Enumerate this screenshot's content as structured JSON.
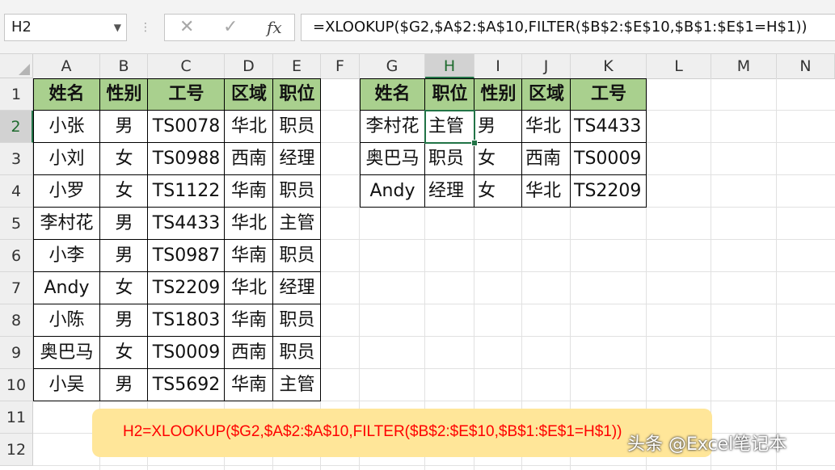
{
  "name_box": {
    "value": "H2"
  },
  "formula_bar": {
    "cancel_icon": "✕",
    "enter_icon": "✓",
    "fx_label": "fx",
    "formula": "=XLOOKUP($G2,$A$2:$A$10,FILTER($B$2:$E$10,$B$1:$E$1=H$1))"
  },
  "columns": [
    "A",
    "B",
    "C",
    "D",
    "E",
    "F",
    "G",
    "H",
    "I",
    "J",
    "K",
    "L",
    "M",
    "N"
  ],
  "rows": [
    "1",
    "2",
    "3",
    "4",
    "5",
    "6",
    "7",
    "8",
    "9",
    "10",
    "11",
    "12"
  ],
  "selected_cell": {
    "col": "H",
    "row": "2"
  },
  "header_color": "#a9d08e",
  "source_table": {
    "headers": [
      "姓名",
      "性别",
      "工号",
      "区域",
      "职位"
    ],
    "rows": [
      [
        "小张",
        "男",
        "TS0078",
        "华北",
        "职员"
      ],
      [
        "小刘",
        "女",
        "TS0988",
        "西南",
        "经理"
      ],
      [
        "小罗",
        "女",
        "TS1122",
        "华南",
        "职员"
      ],
      [
        "李村花",
        "男",
        "TS4433",
        "华北",
        "主管"
      ],
      [
        "小李",
        "男",
        "TS0987",
        "华南",
        "职员"
      ],
      [
        "Andy",
        "女",
        "TS2209",
        "华北",
        "经理"
      ],
      [
        "小陈",
        "男",
        "TS1803",
        "华南",
        "职员"
      ],
      [
        "奥巴马",
        "女",
        "TS0009",
        "西南",
        "职员"
      ],
      [
        "小吴",
        "男",
        "TS5692",
        "华南",
        "主管"
      ]
    ]
  },
  "result_table": {
    "headers": [
      "姓名",
      "职位",
      "性别",
      "区域",
      "工号"
    ],
    "rows": [
      [
        "李村花",
        "主管",
        "男",
        "华北",
        "TS4433"
      ],
      [
        "奥巴马",
        "职员",
        "女",
        "西南",
        "TS0009"
      ],
      [
        "Andy",
        "经理",
        "女",
        "华北",
        "TS2209"
      ]
    ]
  },
  "note": {
    "text": "H2=XLOOKUP($G2,$A$2:$A$10,FILTER($B$2:$E$10,$B$1:$E$1=H$1))",
    "color": "#ff0000",
    "bg": "#ffe699"
  },
  "watermark": {
    "text": "头条 @Excel笔记本"
  }
}
